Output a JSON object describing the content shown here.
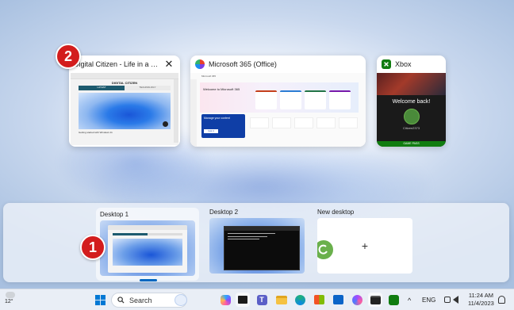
{
  "badges": {
    "one": "1",
    "two": "2"
  },
  "windows": [
    {
      "title": "Digital Citizen - Life in a d...",
      "close": "✕",
      "content": {
        "logo": "DIGITAL CITIZEN",
        "tab1": "LATEST",
        "tab2": "TECHNOLOGY",
        "caption": "Getting started with Windows 11"
      }
    },
    {
      "title": "Microsoft 365 (Office)",
      "content": {
        "brand": "Microsoft 365",
        "welcome": "Welcome to Microsoft 365",
        "popup_title": "Manage your content",
        "popup_btn": "Got it"
      }
    },
    {
      "title": "Xbox",
      "content": {
        "welcome": "Welcome back!",
        "gamertag": "Citizen2373",
        "banner": "GAME PASS"
      }
    }
  ],
  "desktops": [
    {
      "label": "Desktop 1"
    },
    {
      "label": "Desktop 2"
    },
    {
      "label": "New desktop",
      "plus": "+"
    }
  ],
  "taskbar": {
    "weather": "12°",
    "search_placeholder": "Search",
    "language": "ENG",
    "time": "11:24 AM",
    "date": "11/4/2023",
    "tray_chevron": "^"
  },
  "colors": {
    "accent": "#0067c0",
    "badge": "#d31d1d",
    "xbox": "#107c10"
  }
}
